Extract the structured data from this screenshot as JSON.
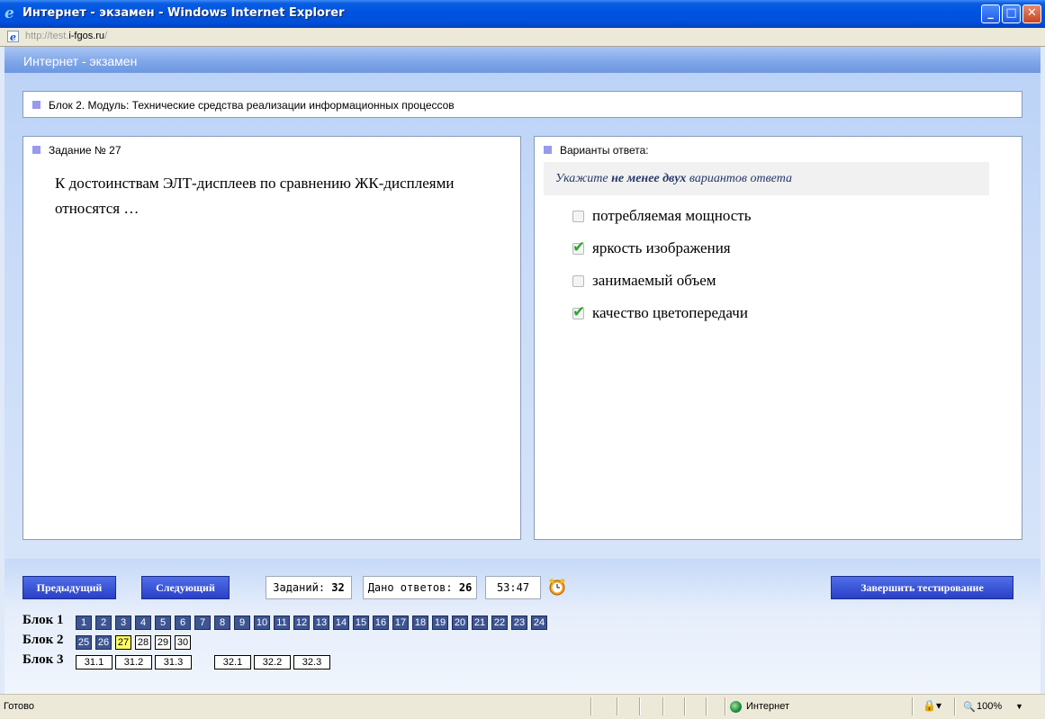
{
  "window": {
    "title": "Интернет - экзамен - Windows Internet Explorer",
    "url_prefix": "http://test.",
    "url_domain": "i-fgos.ru",
    "url_suffix": "/"
  },
  "header": {
    "title": "Интернет - экзамен"
  },
  "block_info": {
    "label": "Блок 2. Модуль: Технические средства реализации информационных процессов"
  },
  "task": {
    "label": "Задание № 27",
    "question": "К достоинствам ЭЛТ-дисплеев по сравнению ЖК-дисплеями относятся …"
  },
  "answers": {
    "label": "Варианты ответа:",
    "hint_pre": "Укажите ",
    "hint_bold": "не менее двух",
    "hint_post": " вариантов ответа",
    "options": [
      {
        "text": "потребляемая мощность",
        "checked": false
      },
      {
        "text": "яркость изображения",
        "checked": true
      },
      {
        "text": "занимаемый объем",
        "checked": false
      },
      {
        "text": "качество цветопередачи",
        "checked": true
      }
    ]
  },
  "controls": {
    "prev": "Предыдущий",
    "next": "Следующий",
    "tasks_label": "Заданий:",
    "tasks_count": "32",
    "answered_label": "Дано ответов:",
    "answered_count": "26",
    "timer": "53:47",
    "finish": "Завершить тестирование"
  },
  "blocks": [
    {
      "label": "Блок 1",
      "items": [
        {
          "n": "1",
          "s": "answered"
        },
        {
          "n": "2",
          "s": "answered"
        },
        {
          "n": "3",
          "s": "answered"
        },
        {
          "n": "4",
          "s": "answered"
        },
        {
          "n": "5",
          "s": "answered"
        },
        {
          "n": "6",
          "s": "answered"
        },
        {
          "n": "7",
          "s": "answered"
        },
        {
          "n": "8",
          "s": "answered"
        },
        {
          "n": "9",
          "s": "answered"
        },
        {
          "n": "10",
          "s": "answered"
        },
        {
          "n": "11",
          "s": "answered"
        },
        {
          "n": "12",
          "s": "answered"
        },
        {
          "n": "13",
          "s": "answered"
        },
        {
          "n": "14",
          "s": "answered"
        },
        {
          "n": "15",
          "s": "answered"
        },
        {
          "n": "16",
          "s": "answered"
        },
        {
          "n": "17",
          "s": "answered"
        },
        {
          "n": "18",
          "s": "answered"
        },
        {
          "n": "19",
          "s": "answered"
        },
        {
          "n": "20",
          "s": "answered"
        },
        {
          "n": "21",
          "s": "answered"
        },
        {
          "n": "22",
          "s": "answered"
        },
        {
          "n": "23",
          "s": "answered"
        },
        {
          "n": "24",
          "s": "answered"
        }
      ]
    },
    {
      "label": "Блок 2",
      "items": [
        {
          "n": "25",
          "s": "answered"
        },
        {
          "n": "26",
          "s": "answered"
        },
        {
          "n": "27",
          "s": "current"
        },
        {
          "n": "28",
          "s": "open"
        },
        {
          "n": "29",
          "s": "open"
        },
        {
          "n": "30",
          "s": "open"
        }
      ]
    },
    {
      "label": "Блок 3",
      "items": [
        {
          "n": "31.1",
          "s": "open"
        },
        {
          "n": "31.2",
          "s": "open"
        },
        {
          "n": "31.3",
          "s": "open"
        },
        {
          "n": "32.1",
          "s": "open"
        },
        {
          "n": "32.2",
          "s": "open"
        },
        {
          "n": "32.3",
          "s": "open"
        }
      ]
    }
  ],
  "statusbar": {
    "text": "Готово",
    "zone": "Интернет",
    "zoom": "100%"
  }
}
